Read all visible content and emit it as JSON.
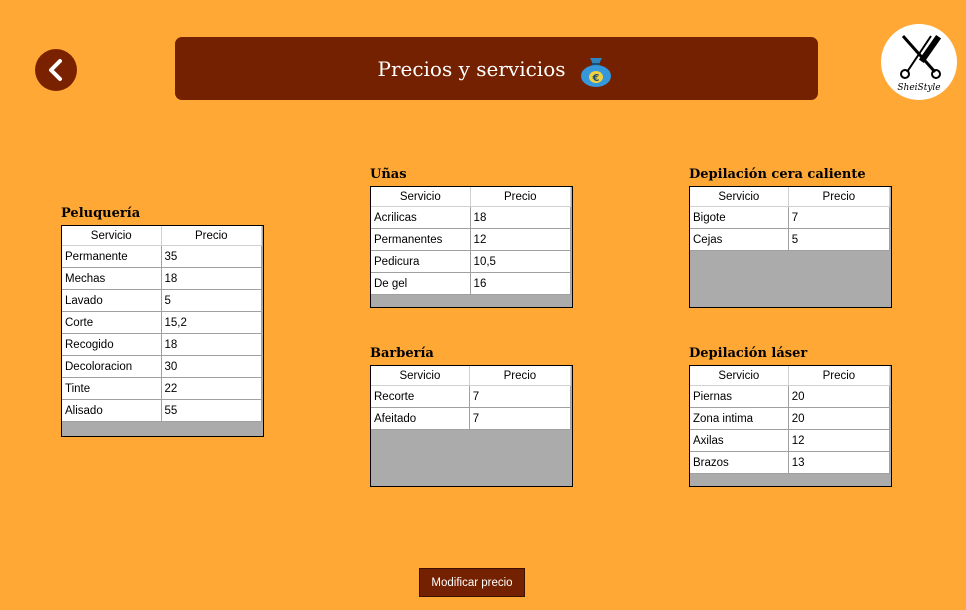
{
  "header": {
    "title": "Precios y servicios",
    "icon": "money-bag-euro-icon"
  },
  "logo": {
    "text": "SheiStyle",
    "icon": "scissors-comb-icon"
  },
  "back_icon": "back-arrow-icon",
  "columns": {
    "service": "Servicio",
    "price": "Precio"
  },
  "sections": {
    "peluqueria": {
      "title": "Peluquería",
      "rows": [
        [
          "Permanente",
          "35"
        ],
        [
          "Mechas",
          "18"
        ],
        [
          "Lavado",
          "5"
        ],
        [
          "Corte",
          "15,2"
        ],
        [
          "Recogido",
          "18"
        ],
        [
          "Decoloracion",
          "30"
        ],
        [
          "Tinte",
          "22"
        ],
        [
          "Alisado",
          "55"
        ]
      ]
    },
    "unas": {
      "title": "Uñas",
      "rows": [
        [
          "Acrilicas",
          "18"
        ],
        [
          "Permanentes",
          "12"
        ],
        [
          "Pedicura",
          "10,5"
        ],
        [
          "De gel",
          "16"
        ]
      ]
    },
    "barberia": {
      "title": "Barbería",
      "rows": [
        [
          "Recorte",
          "7"
        ],
        [
          "Afeitado",
          "7"
        ]
      ]
    },
    "depilacion_cera": {
      "title": "Depilación cera caliente",
      "rows": [
        [
          "Bigote",
          "7"
        ],
        [
          "Cejas",
          "5"
        ]
      ]
    },
    "depilacion_laser": {
      "title": "Depilación láser",
      "rows": [
        [
          "Piernas",
          "20"
        ],
        [
          "Zona intima",
          "20"
        ],
        [
          "Axilas",
          "12"
        ],
        [
          "Brazos",
          "13"
        ]
      ]
    }
  },
  "actions": {
    "modify_label": "Modificar precio"
  },
  "colors": {
    "background": "#FFA836",
    "header": "#732100",
    "grid_empty": "#ABABAB"
  }
}
